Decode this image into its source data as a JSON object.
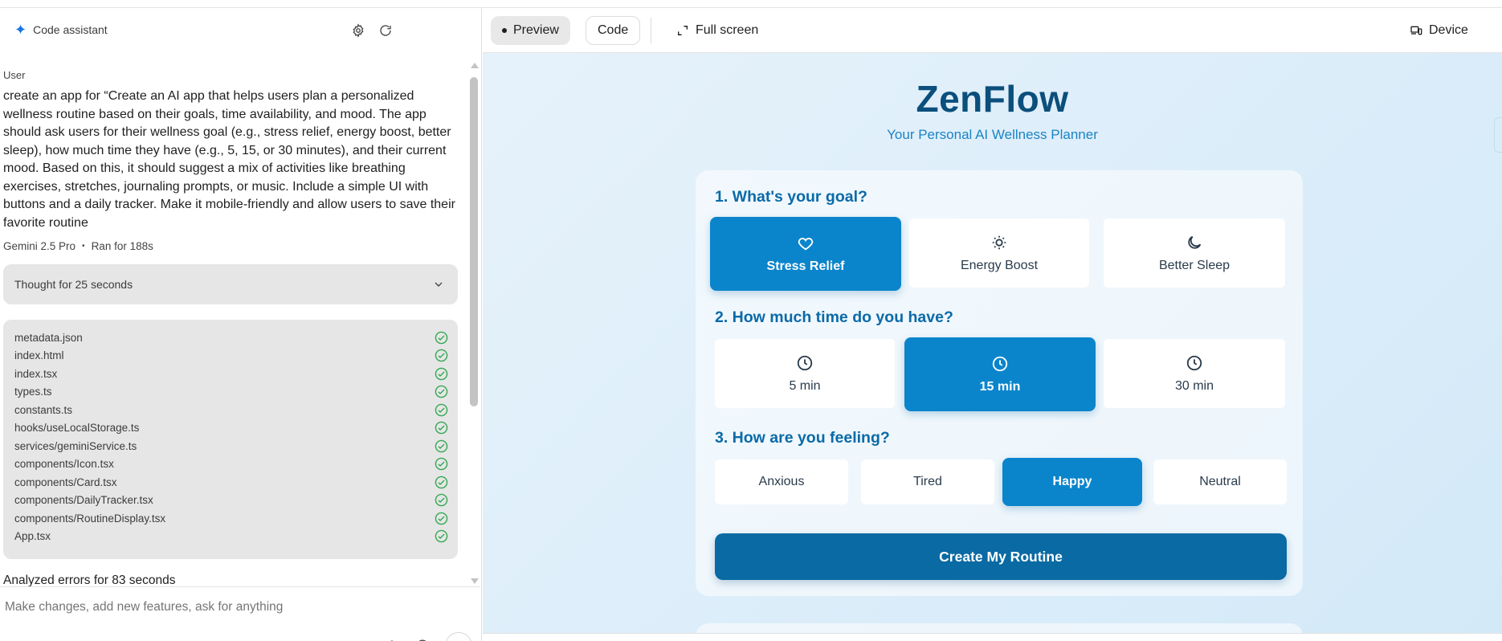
{
  "assistant": {
    "title": "Code assistant",
    "user_label": "User",
    "prompt": "create an app for “Create an AI app that helps users plan a personalized wellness routine based on their goals, time availability, and mood. The app should ask users for their wellness goal (e.g., stress relief, energy boost, better sleep), how much time they have (e.g., 5, 15, or 30 minutes), and their current mood. Based on this, it should suggest a mix of activities like breathing exercises, stretches, journaling prompts, or music. Include a simple UI with buttons and a daily tracker. Make it mobile-friendly and allow users to save their favorite routine",
    "model": "Gemini 2.5 Pro",
    "run_time": "Ran for 188s",
    "thought": "Thought for 25 seconds",
    "files": [
      "metadata.json",
      "index.html",
      "index.tsx",
      "types.ts",
      "constants.ts",
      "hooks/useLocalStorage.ts",
      "services/geminiService.ts",
      "components/Icon.tsx",
      "components/Card.tsx",
      "components/DailyTracker.tsx",
      "components/RoutineDisplay.tsx",
      "App.tsx"
    ],
    "analyzed": "Analyzed errors for 83 seconds",
    "input_placeholder": "Make changes, add new features, ask for anything"
  },
  "toolbar": {
    "preview": "Preview",
    "code": "Code",
    "full_screen": "Full screen",
    "device": "Device"
  },
  "app": {
    "title": "ZenFlow",
    "subtitle": "Your Personal AI Wellness Planner",
    "q1": "1. What's your goal?",
    "goals": [
      {
        "label": "Stress Relief",
        "icon": "heart-icon",
        "selected": true
      },
      {
        "label": "Energy Boost",
        "icon": "sun-icon",
        "selected": false
      },
      {
        "label": "Better Sleep",
        "icon": "moon-icon",
        "selected": false
      }
    ],
    "q2": "2. How much time do you have?",
    "times": [
      {
        "label": "5 min",
        "icon": "clock-icon",
        "selected": false
      },
      {
        "label": "15 min",
        "icon": "clock-icon",
        "selected": true
      },
      {
        "label": "30 min",
        "icon": "clock-icon",
        "selected": false
      }
    ],
    "q3": "3. How are you feeling?",
    "moods": [
      {
        "label": "Anxious",
        "selected": false
      },
      {
        "label": "Tired",
        "selected": false
      },
      {
        "label": "Happy",
        "selected": true
      },
      {
        "label": "Neutral",
        "selected": false
      }
    ],
    "create_button": "Create My Routine"
  },
  "colors": {
    "accent": "#0a85cc",
    "title": "#0b4f7c",
    "create_button": "#0a6aa3",
    "check": "#34a853"
  }
}
